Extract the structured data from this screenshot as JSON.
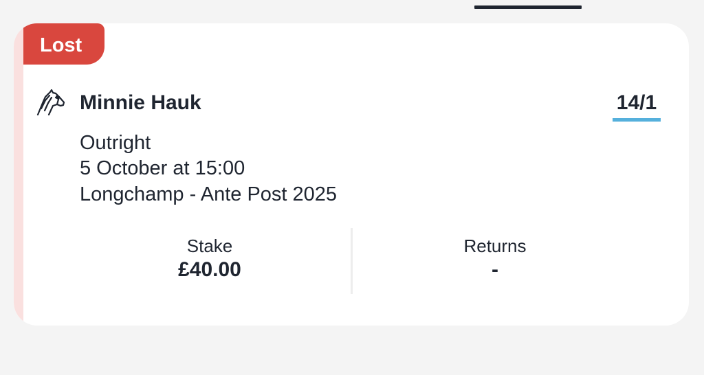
{
  "bet": {
    "status": "Lost",
    "selection": "Minnie Hauk",
    "odds": "14/1",
    "market": "Outright",
    "time": "5 October at 15:00",
    "event": "Longchamp - Ante Post 2025",
    "stake_label": "Stake",
    "stake_value": "£40.00",
    "returns_label": "Returns",
    "returns_value": "-",
    "sport_icon": "horse-head-icon"
  },
  "colors": {
    "status_lost": "#d9473e",
    "odds_underline": "#55b0dc",
    "card_accent": "#fae0df",
    "text": "#1f2530"
  }
}
